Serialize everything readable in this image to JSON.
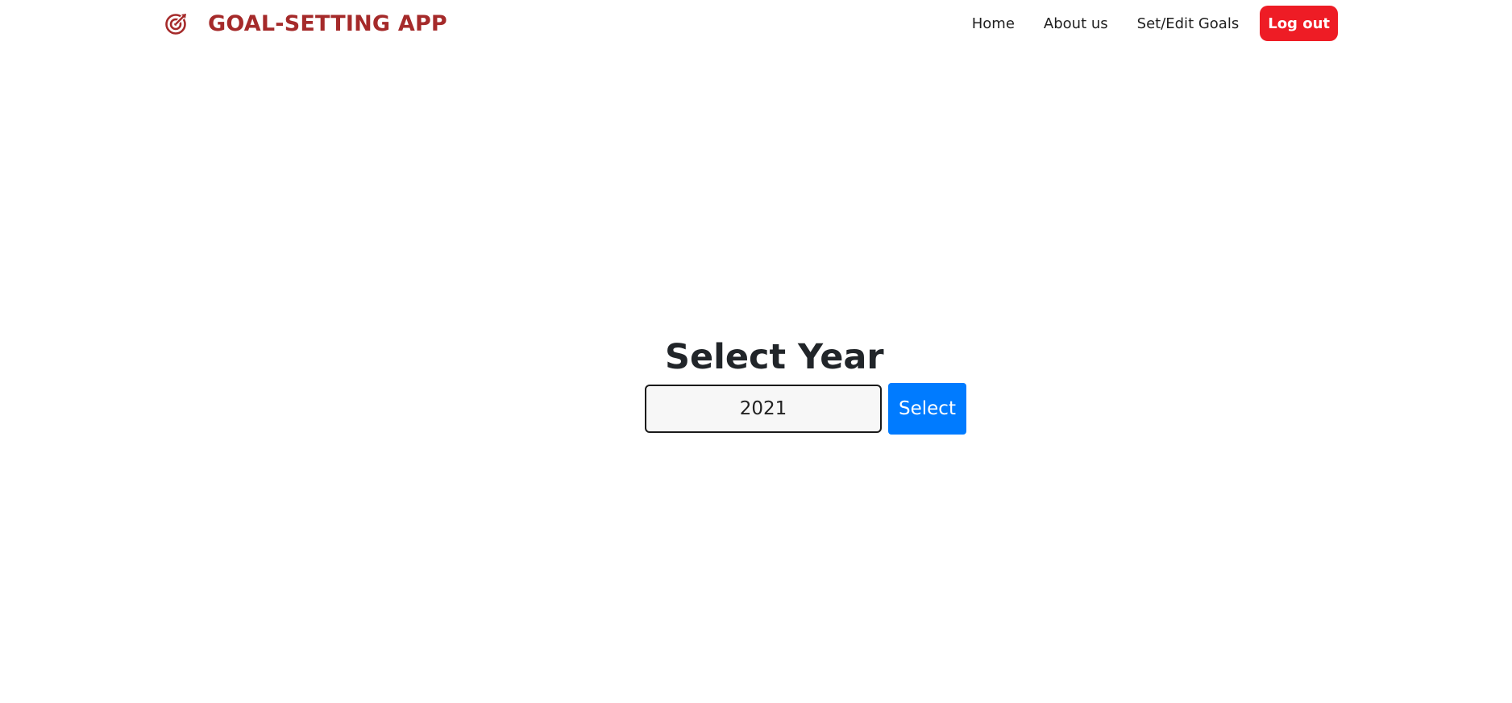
{
  "brand": {
    "icon": "target-icon",
    "title": "GOAL-SETTING APP",
    "color": "#a52a2a"
  },
  "nav": {
    "links": [
      {
        "label": "Home"
      },
      {
        "label": "About us"
      },
      {
        "label": "Set/Edit Goals"
      }
    ],
    "logout_label": "Log out",
    "logout_color": "#ee1c25"
  },
  "year_form": {
    "title": "Select Year",
    "input_value": "2021",
    "button_label": "Select",
    "button_color": "#007bff"
  }
}
